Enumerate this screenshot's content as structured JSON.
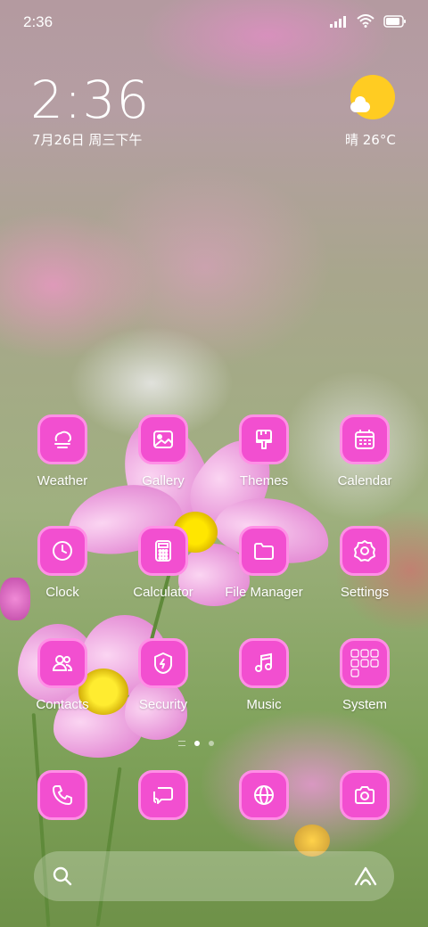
{
  "status_bar": {
    "time": "2:36",
    "icons": [
      "signal-icon",
      "wifi-icon",
      "battery-icon"
    ]
  },
  "clock_widget": {
    "time": "2:36",
    "date": "7月26日 周三下午"
  },
  "weather_widget": {
    "condition_icon": "sun-cloud-icon",
    "text": "晴 26°C"
  },
  "apps": [
    {
      "label": "Weather",
      "icon": "weather-icon"
    },
    {
      "label": "Gallery",
      "icon": "gallery-icon"
    },
    {
      "label": "Themes",
      "icon": "themes-icon"
    },
    {
      "label": "Calendar",
      "icon": "calendar-icon"
    },
    {
      "label": "Clock",
      "icon": "clock-icon"
    },
    {
      "label": "Calculator",
      "icon": "calculator-icon"
    },
    {
      "label": "File Manager",
      "icon": "folder-icon"
    },
    {
      "label": "Settings",
      "icon": "gear-icon"
    },
    {
      "label": "Contacts",
      "icon": "contacts-icon"
    },
    {
      "label": "Security",
      "icon": "shield-icon"
    },
    {
      "label": "Music",
      "icon": "music-icon"
    },
    {
      "label": "System",
      "icon": "folder-grid-icon"
    }
  ],
  "pager": {
    "pages": 2,
    "current": 1
  },
  "dock": [
    {
      "icon": "phone-icon"
    },
    {
      "icon": "messages-icon"
    },
    {
      "icon": "browser-icon"
    },
    {
      "icon": "camera-icon"
    }
  ],
  "search_bar": {
    "left_icon": "search-icon",
    "right_icon": "assistant-icon"
  },
  "colors": {
    "icon_fill": "#f24fd0",
    "icon_border": "#ff8fe6",
    "sun": "#ffcc22"
  }
}
